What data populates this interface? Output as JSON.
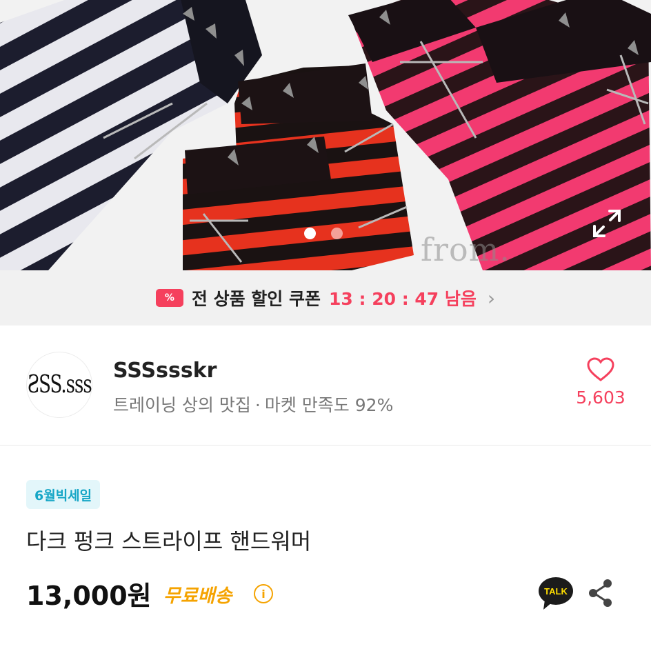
{
  "hero": {
    "watermark": "from.",
    "slide_count": 2,
    "active_slide": 1
  },
  "coupon": {
    "badge": "%",
    "label": "전 상품 할인 쿠폰",
    "timer": "13 : 20 : 47 남음"
  },
  "shop": {
    "avatar_text": "ƧSS.sss",
    "name": "SSSssskr",
    "desc_main": "트레이닝 상의 맛집",
    "desc_sep": "·",
    "desc_rating": "마켓 만족도 92%",
    "like_count": "5,603"
  },
  "product": {
    "tag": "6월빅세일",
    "title": "다크 펑크 스트라이프 핸드워머",
    "price": "13,000원",
    "shipping": "무료배송",
    "shipping_info_icon": "i"
  },
  "actions": {
    "talk_label": "TALK"
  },
  "colors": {
    "accent": "#f5405d",
    "shipping": "#f5a300",
    "tag_text": "#16a6c6",
    "tag_bg": "#e3f6fa"
  }
}
